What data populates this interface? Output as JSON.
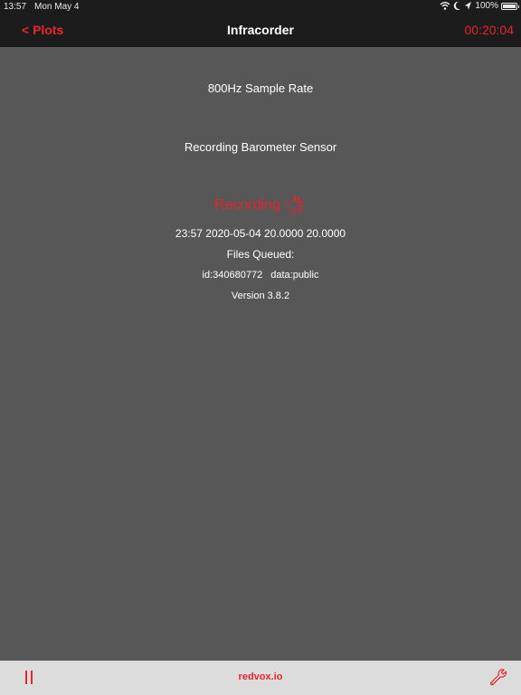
{
  "status_bar": {
    "time": "13:57",
    "date": "Mon May 4",
    "battery": "100%",
    "icons": [
      "wifi-icon",
      "moon-icon",
      "location-arrow-icon",
      "battery-icon"
    ]
  },
  "nav": {
    "back_label": "< Plots",
    "title": "Infracorder",
    "timer": "00:20:04"
  },
  "main": {
    "sample_rate": "800Hz Sample Rate",
    "sensor_status": "Recording Barometer Sensor",
    "recording_label": "Recording",
    "timestamp": "23:57 2020-05-04 20.0000 20.0000",
    "files_queued": "Files Queued:",
    "device_id": "id:340680772",
    "data_visibility": "data:public",
    "version": "Version 3.8.2"
  },
  "toolbar": {
    "link": "redvox.io",
    "icons": [
      "pause-icon",
      "wrench-icon"
    ]
  },
  "colors": {
    "accent": "#e8242c",
    "background": "#575757",
    "bar_background": "#1c1c1c",
    "toolbar_background": "#dcdcdc"
  }
}
